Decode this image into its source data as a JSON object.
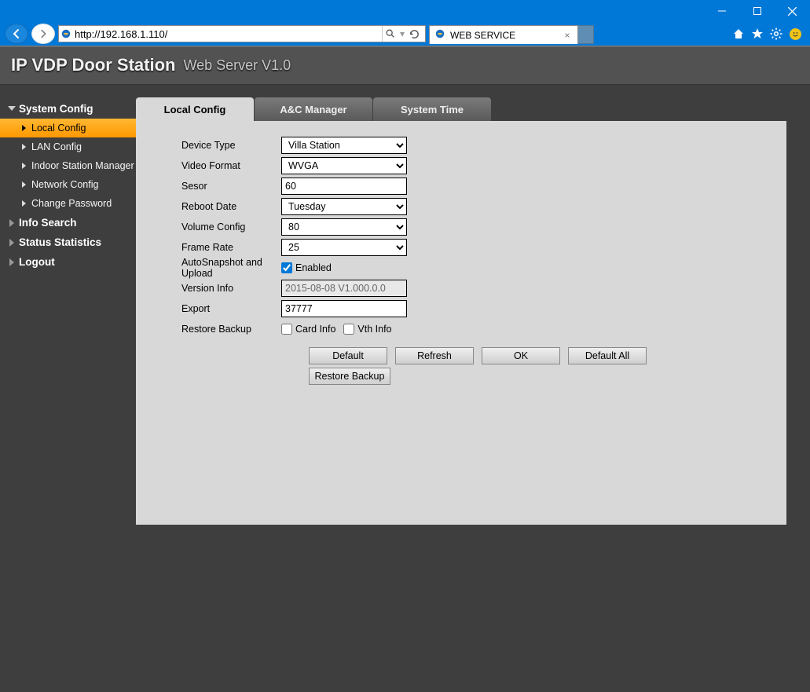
{
  "browser": {
    "url": "http://192.168.1.110/",
    "tab_title": "WEB SERVICE"
  },
  "header": {
    "title": "IP VDP Door Station",
    "subtitle": "Web Server V1.0"
  },
  "sidebar": {
    "sections": [
      {
        "label": "System Config",
        "expanded": true,
        "items": [
          "Local Config",
          "LAN Config",
          "Indoor Station Manager",
          "Network Config",
          "Change Password"
        ]
      },
      {
        "label": "Info Search",
        "expanded": false
      },
      {
        "label": "Status Statistics",
        "expanded": false
      },
      {
        "label": "Logout",
        "expanded": false
      }
    ]
  },
  "tabs": {
    "items": [
      "Local Config",
      "A&C Manager",
      "System Time"
    ]
  },
  "form": {
    "device_type": {
      "label": "Device Type",
      "value": "Villa Station"
    },
    "video_format": {
      "label": "Video Format",
      "value": "WVGA"
    },
    "sesor": {
      "label": "Sesor",
      "value": "60"
    },
    "reboot_date": {
      "label": "Reboot Date",
      "value": "Tuesday"
    },
    "volume_config": {
      "label": "Volume Config",
      "value": "80"
    },
    "frame_rate": {
      "label": "Frame Rate",
      "value": "25"
    },
    "autosnapshot": {
      "label": "AutoSnapshot and Upload",
      "checkbox_label": "Enabled",
      "checked": true
    },
    "version_info": {
      "label": "Version Info",
      "value": "2015-08-08 V1.000.0.0"
    },
    "export": {
      "label": "Export",
      "value": "37777"
    },
    "restore_backup": {
      "label": "Restore Backup",
      "card_label": "Card Info",
      "vth_label": "Vth Info"
    }
  },
  "buttons": {
    "default": "Default",
    "refresh": "Refresh",
    "ok": "OK",
    "default_all": "Default All",
    "restore_backup": "Restore Backup"
  }
}
